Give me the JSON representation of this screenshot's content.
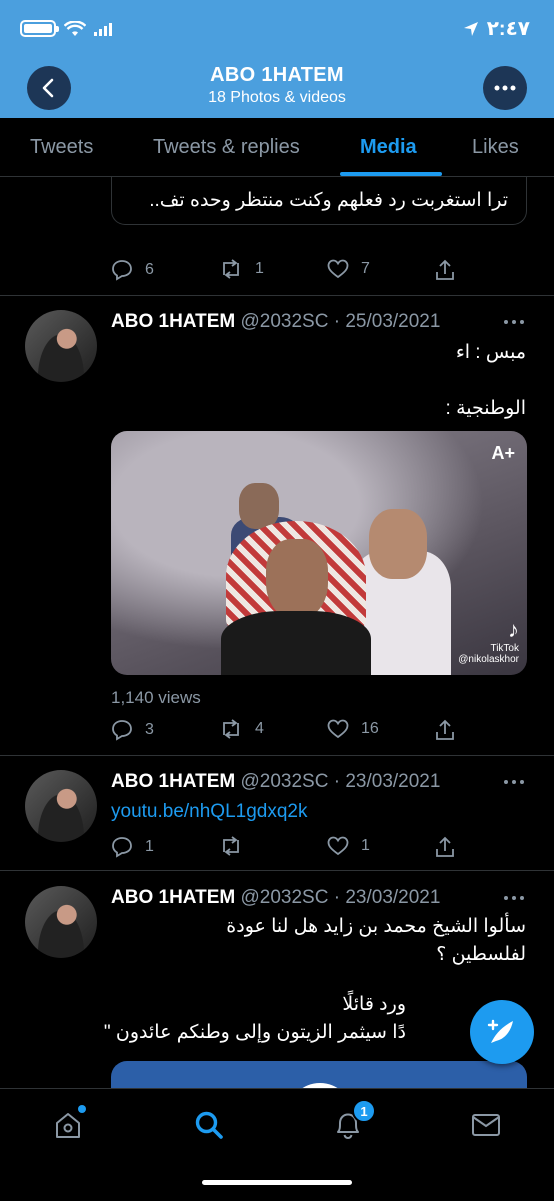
{
  "status_bar": {
    "time": "٢:٤٧",
    "battery_percent": 100
  },
  "header": {
    "title": "ABO 1HATEM",
    "subtitle": "18 Photos & videos",
    "bg_color": "#4b9fde"
  },
  "tabs": [
    {
      "label": "Tweets",
      "active": false
    },
    {
      "label": "Tweets & replies",
      "active": false
    },
    {
      "label": "Media",
      "active": true
    },
    {
      "label": "Likes",
      "active": false
    }
  ],
  "feed": {
    "partial_tweet": {
      "quote_text": "ترا استغربت رد فعلهم وكنت منتظر وحده تف..",
      "replies": "6",
      "retweets": "1",
      "likes": "7"
    },
    "tweets": [
      {
        "name": "ABO 1HATEM",
        "handle": "@2032SC",
        "date": "· 25/03/2021",
        "line1": "مبس : اء",
        "line2": "الوطنجية :",
        "media_badge": "A+",
        "media_watermark": "TikTok",
        "media_watermark_user": "@nikolaskhor",
        "views": "1,140 views",
        "replies": "3",
        "retweets": "4",
        "likes": "16"
      },
      {
        "name": "ABO 1HATEM",
        "handle": "@2032SC",
        "date": "· 23/03/2021",
        "link": "youtu.be/nhQL1gdxq2k",
        "replies": "1",
        "retweets": "",
        "likes": "1"
      },
      {
        "name": "ABO 1HATEM",
        "handle": "@2032SC",
        "date": "· 23/03/2021",
        "line1": "سألوا الشيخ محمد بن زايد هل لنا عودة",
        "line2": "لفلسطين ؟",
        "line3": "ورد قائلًا",
        "line4": "دًا سيثمر الزيتون وإلى وطنكم عائدون \""
      }
    ]
  },
  "bottom_nav": {
    "notifications_count": "1"
  },
  "colors": {
    "accent": "#1d9bf0",
    "muted": "#8b98a5",
    "divider": "#2f3336"
  }
}
